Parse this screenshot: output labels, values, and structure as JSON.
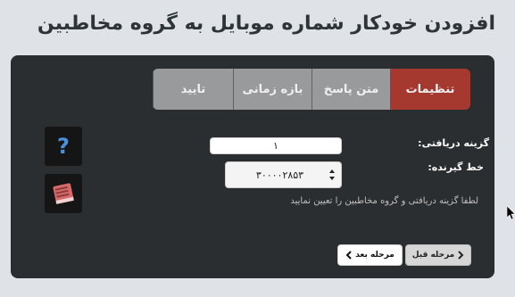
{
  "page": {
    "title": "افزودن خودکار شماره موبایل به گروه مخاطبین"
  },
  "tabs": [
    {
      "label": "تنظیمات",
      "active": true
    },
    {
      "label": "متن پاسخ",
      "active": false
    },
    {
      "label": "بازه زمانی",
      "active": false
    },
    {
      "label": "تایید",
      "active": false
    }
  ],
  "form": {
    "option_label": "گزینه دریافتی:",
    "option_value": "۱",
    "line_label": "خط گیرنده:",
    "line_value": "۳۰۰۰۰۲۸۵۳",
    "hint": "لطفا گزینه دریافتی و گروه مخاطبین را تعیین نمایید"
  },
  "side_buttons": [
    {
      "icon": "question-icon",
      "color": "#4a90d9"
    },
    {
      "icon": "book-icon",
      "color": "#d66a6a"
    }
  ],
  "nav": {
    "next_label": "مرحله بعد",
    "prev_label": "مرحله قبل"
  },
  "colors": {
    "accent": "#a6392f",
    "panel": "#2b2e31",
    "tab_inactive": "#999a9c"
  }
}
